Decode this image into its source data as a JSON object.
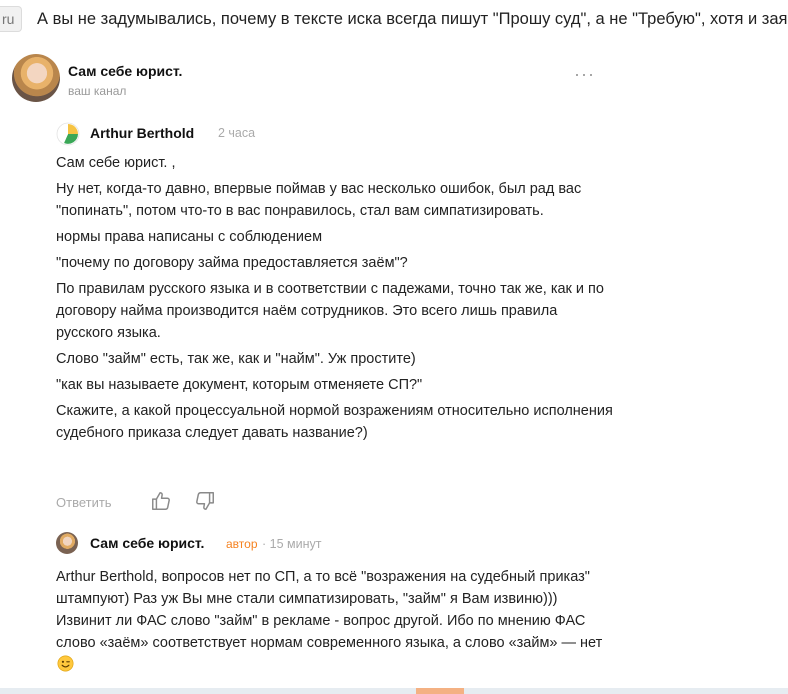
{
  "header": {
    "tab_stub": "ru",
    "article_title": "А вы не задумывались, почему в тексте иска всегда пишут \"Прошу суд\", а не \"Требую\", хотя и заявля..."
  },
  "channel": {
    "name": "Сам себе юрист.",
    "subtitle": "ваш канал",
    "more_label": "···"
  },
  "comments": [
    {
      "author": "Arthur Berthold",
      "time": "2 часа",
      "paragraphs": [
        "Сам себе юрист. ,",
        "Ну нет, когда-то давно, впервые поймав у вас несколько ошибок, был рад вас \"попинать\", потом что-то в вас понравилось, стал вам симпатизировать.",
        "нормы права написаны с соблюдением",
        "\"почему по договору займа предоставляется заём\"?",
        "По правилам русского языка и в соответствии с падежами, точно так же, как и по договору найма производится наём сотрудников. Это всего лишь правила русского языка.",
        "Слово \"займ\" есть, так же, как и \"найм\". Уж простите)",
        "\"как вы называете документ, которым отменяете СП?\"",
        "Скажите, а какой процессуальной нормой возражениям относительно исполнения судебного приказа следует давать название?)"
      ],
      "actions": {
        "reply": "Ответить",
        "like_icon": "thumbs-up-icon",
        "dislike_icon": "thumbs-down-icon"
      }
    },
    {
      "author": "Сам себе юрист.",
      "badge": "автор",
      "time": "· 15 минут",
      "text": "Arthur Berthold, вопросов нет по СП, а то всё \"возражения на судебный приказ\" штампуют) Раз уж Вы мне стали симпатизировать, \"займ\" я Вам извиню))) Извинит ли ФАС слово \"займ\" в рекламе - вопрос другой. Ибо по мнению ФАС слово «заём» соответствует нормам современного языка, а слово «займ» — нет",
      "emoji_icon": "winking-smiley-icon"
    }
  ],
  "colors": {
    "accent_orange": "#f58220",
    "muted_text": "#aaaaaa"
  }
}
